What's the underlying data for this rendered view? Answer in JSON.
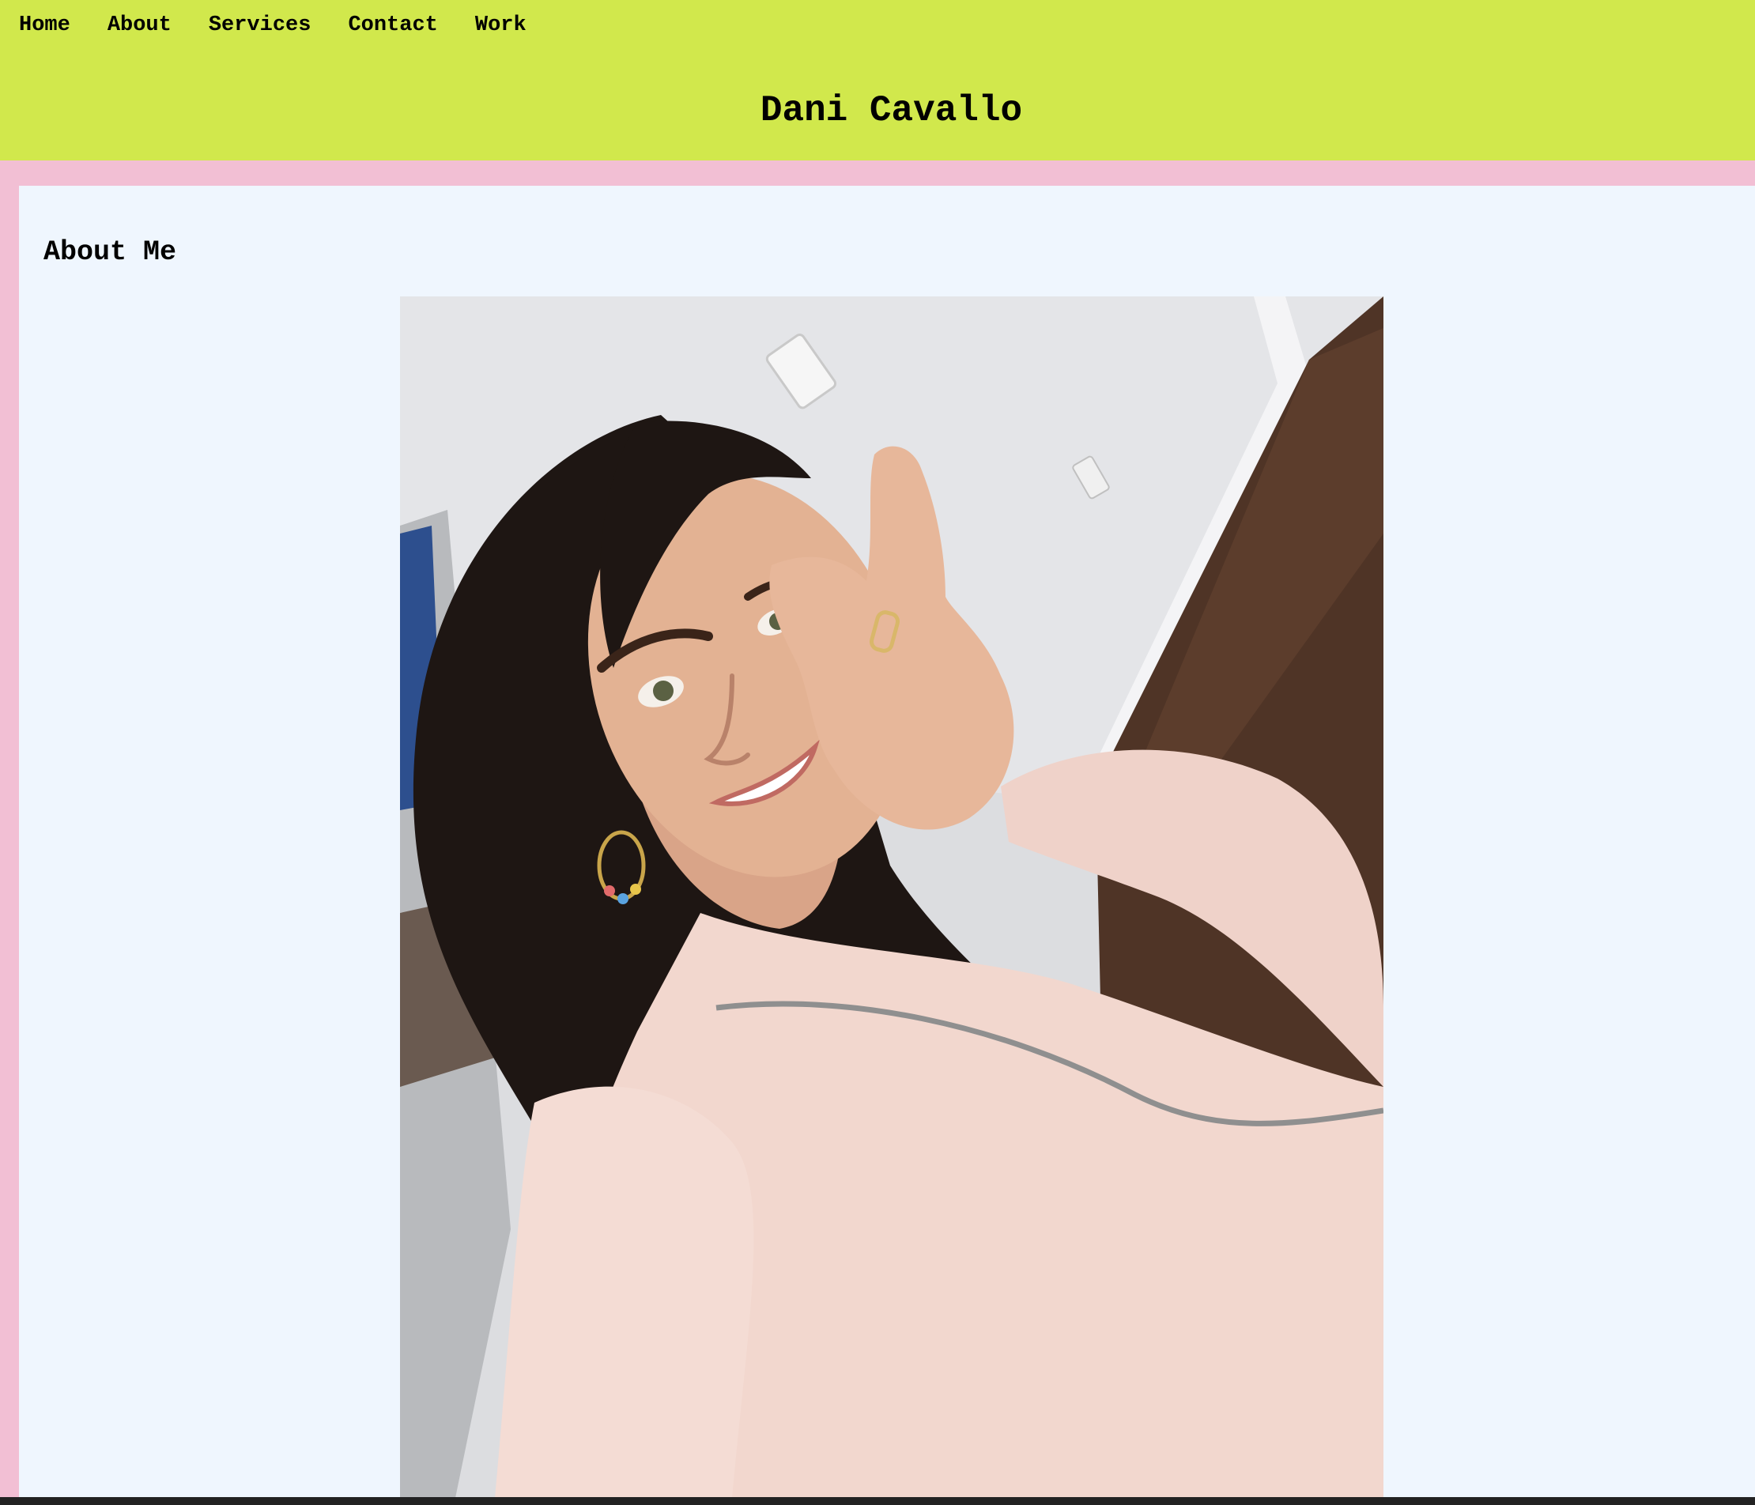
{
  "nav": {
    "items": [
      {
        "label": "Home"
      },
      {
        "label": "About"
      },
      {
        "label": "Services"
      },
      {
        "label": "Contact"
      },
      {
        "label": "Work"
      }
    ]
  },
  "header": {
    "title": "Dani Cavallo"
  },
  "main": {
    "heading": "About Me",
    "photo_alt": "Selfie of Dani Cavallo"
  },
  "colors": {
    "header_bg": "#d1e84c",
    "page_bg": "#f2bfd4",
    "content_bg": "#eff6fe",
    "text": "#000000"
  }
}
